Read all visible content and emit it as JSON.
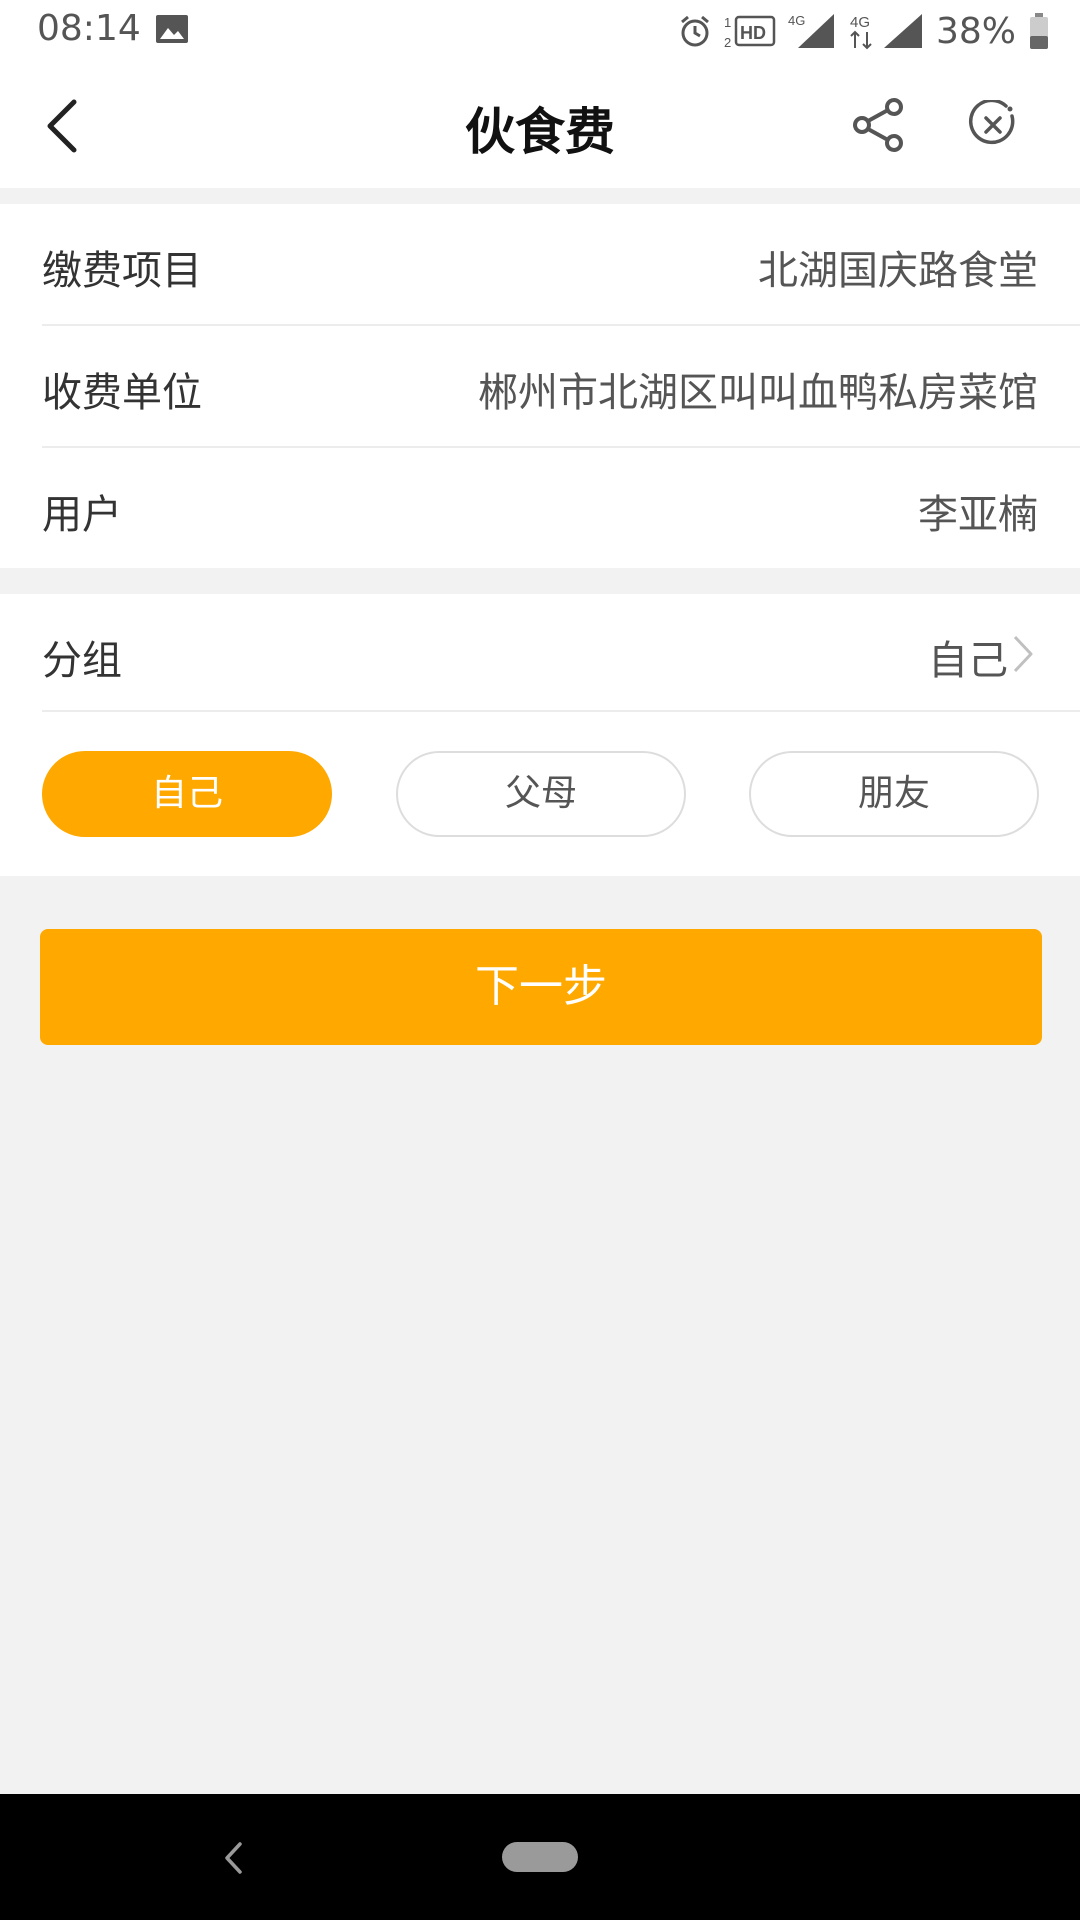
{
  "status_bar": {
    "time": "08:14",
    "battery": "38%",
    "icons": [
      "gallery-icon",
      "alarm-icon",
      "hd-icon",
      "signal-4g-icon",
      "signal-4g-icon",
      "battery-icon"
    ]
  },
  "header": {
    "title": "伙食费",
    "back_icon": "chevron-left-icon",
    "share_icon": "share-icon",
    "close_icon": "close-circle-icon"
  },
  "info": {
    "rows": [
      {
        "label": "缴费项目",
        "value": "北湖国庆路食堂"
      },
      {
        "label": "收费单位",
        "value": "郴州市北湖区叫叫血鸭私房菜馆"
      },
      {
        "label": "用户",
        "value": "李亚楠"
      }
    ]
  },
  "group": {
    "label": "分组",
    "value": "自己",
    "options": [
      {
        "label": "自己",
        "selected": true
      },
      {
        "label": "父母",
        "selected": false
      },
      {
        "label": "朋友",
        "selected": false
      }
    ]
  },
  "next_button": {
    "label": "下一步"
  },
  "colors": {
    "accent": "#fea800",
    "background": "#f2f2f2"
  }
}
